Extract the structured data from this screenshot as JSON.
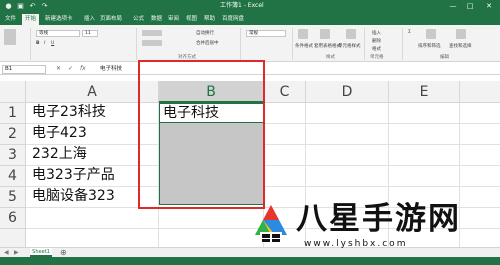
{
  "window": {
    "title": "工作簿1 - Excel",
    "min": "—",
    "max": "□",
    "close": "✕"
  },
  "ribbon_tabs": [
    "文件",
    "开始",
    "新建选项卡",
    "插入",
    "页面布局",
    "公式",
    "数据",
    "审阅",
    "视图",
    "帮助",
    "百度网盘"
  ],
  "active_tab": "开始",
  "ribbon": {
    "font_name": "等线",
    "font_size": "11",
    "wrap_text": "自动换行",
    "merge_center": "合并后居中",
    "number_format": "常规",
    "conditional_format": "条件格式",
    "format_as_table": "套用表格格式",
    "cell_styles": "单元格样式",
    "insert": "插入",
    "delete": "删除",
    "format": "格式",
    "sort_filter": "排序和筛选",
    "find_select": "查找和选择",
    "group_alignment": "对齐方式",
    "group_styles": "样式",
    "group_cells": "单元格",
    "group_editing": "编辑"
  },
  "formula_bar": {
    "name_box": "B1",
    "cancel": "✕",
    "enter": "✓",
    "fx": "fx",
    "content": "电子科技"
  },
  "columns": [
    "A",
    "B",
    "C",
    "D",
    "E"
  ],
  "selected_column": "B",
  "rows": [
    "1",
    "2",
    "3",
    "4",
    "5",
    "6"
  ],
  "cells": {
    "A1": "电子23科技",
    "A2": "电子423",
    "A3": "232上海",
    "A4": "电323子产品",
    "A5": "电脑设备323",
    "B1": "电子科技"
  },
  "sheet": {
    "tab": "Sheet1",
    "add": "⊕",
    "prev": "◀",
    "next": "▶"
  },
  "watermark": {
    "name": "八星手游网",
    "url": "www.lyshbx.com"
  }
}
